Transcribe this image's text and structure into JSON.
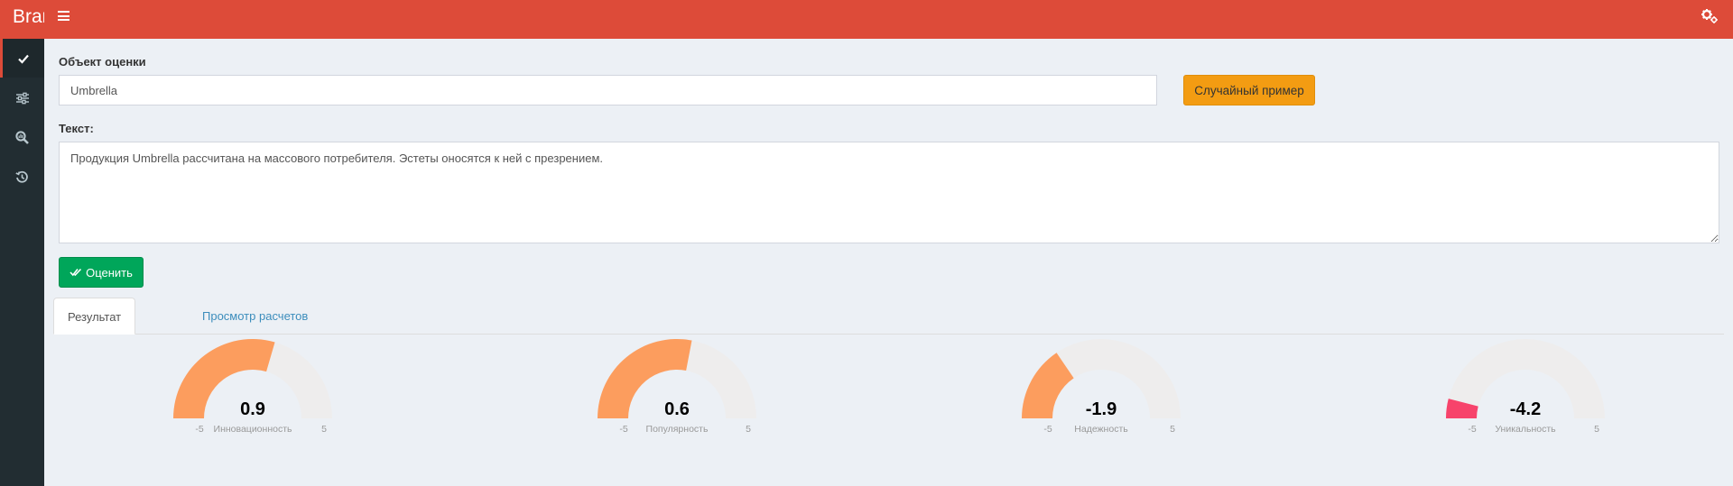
{
  "header": {
    "brand": "Brand",
    "menu_icon": "hamburger-icon",
    "settings_icon": "gears-icon",
    "color": "#dd4b39"
  },
  "sidebar": {
    "items": [
      {
        "icon": "check-icon",
        "active": true
      },
      {
        "icon": "sliders-icon",
        "active": false
      },
      {
        "icon": "search-chart-icon",
        "active": false
      },
      {
        "icon": "history-icon",
        "active": false
      }
    ]
  },
  "form": {
    "object_label": "Объект оценки",
    "object_value": "Umbrella",
    "random_button": "Случайный пример",
    "text_label": "Текст:",
    "text_value": "Продукция Umbrella рассчитана на массового потребителя. Эстеты оносятся к ней с презрением.",
    "evaluate_button": "Оценить"
  },
  "tabs": [
    {
      "label": "Результат",
      "active": true
    },
    {
      "label": "Просмотр расчетов",
      "active": false
    }
  ],
  "gauges": [
    {
      "value": 0.9,
      "display": "0.9",
      "label": "Инновационность",
      "min": -5,
      "max": 5,
      "min_label": "-5",
      "max_label": "5",
      "color": "#fc9d5e"
    },
    {
      "value": 0.6,
      "display": "0.6",
      "label": "Популярность",
      "min": -5,
      "max": 5,
      "min_label": "-5",
      "max_label": "5",
      "color": "#fc9d5e"
    },
    {
      "value": -1.9,
      "display": "-1.9",
      "label": "Надежность",
      "min": -5,
      "max": 5,
      "min_label": "-5",
      "max_label": "5",
      "color": "#fc9d5e"
    },
    {
      "value": -4.2,
      "display": "-4.2",
      "label": "Уникальность",
      "min": -5,
      "max": 5,
      "min_label": "-5",
      "max_label": "5",
      "color": "#f7436b"
    }
  ],
  "gauge_track_color": "#eeeded",
  "accent": {
    "orange_button": "#f39c12",
    "green_button": "#00a65a",
    "link": "#3c8dbc"
  }
}
